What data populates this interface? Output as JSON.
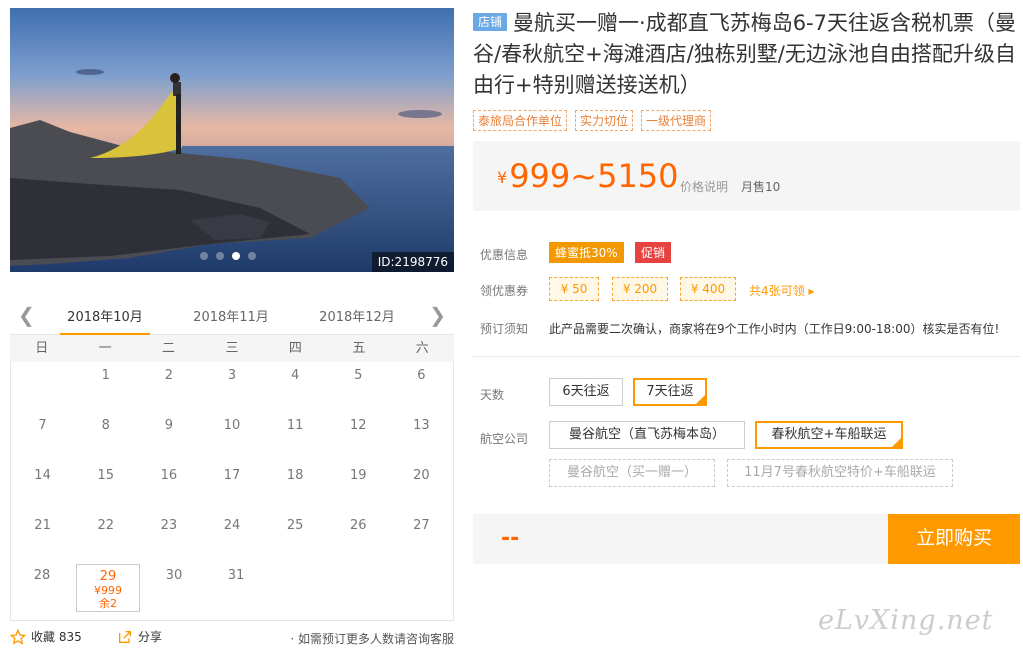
{
  "hero": {
    "image_id": "ID:2198776",
    "slide_count": 4,
    "active_slide": 2
  },
  "calendar": {
    "months": [
      "2018年10月",
      "2018年11月",
      "2018年12月"
    ],
    "active_month": 0,
    "weekdays": [
      "日",
      "一",
      "二",
      "三",
      "四",
      "五",
      "六"
    ],
    "rows": [
      [
        "",
        "1",
        "2",
        "3",
        "4",
        "5",
        "6"
      ],
      [
        "7",
        "8",
        "9",
        "10",
        "11",
        "12",
        "13"
      ],
      [
        "14",
        "15",
        "16",
        "17",
        "18",
        "19",
        "20"
      ],
      [
        "21",
        "22",
        "23",
        "24",
        "25",
        "26",
        "27"
      ],
      [
        "28",
        "29",
        "30",
        "31",
        "",
        "",
        ""
      ]
    ],
    "selected": {
      "day": "29",
      "price": "¥999",
      "remaining": "余2"
    }
  },
  "footer_left": {
    "favorite_label": "收藏 835",
    "share_label": "分享",
    "consult_note": "· 如需预订更多人数请咨询客服"
  },
  "product": {
    "store_tag": "店铺",
    "title": "曼航买一赠一·成都直飞苏梅岛6-7天往返含税机票（曼谷/春秋航空+海滩酒店/独栋别墅/无边泳池自由搭配升级自由行+特别赠送接送机）",
    "badges": [
      "泰旅局合作单位",
      "实力切位",
      "一级代理商"
    ]
  },
  "price": {
    "currency": "¥",
    "range": "999~5150",
    "explain": "价格说明",
    "sales": "月售10"
  },
  "promo": {
    "label": "优惠信息",
    "tags": [
      {
        "text": "蜂蜜抵30%",
        "color": "#f39800"
      },
      {
        "text": "促销",
        "color": "#e64340"
      }
    ]
  },
  "coupons": {
    "label": "领优惠券",
    "items": [
      "¥ 50",
      "¥ 200",
      "¥ 400"
    ],
    "more": "共4张可领 ▸"
  },
  "booking": {
    "label": "预订须知",
    "text": "此产品需要二次确认，商家将在9个工作小时内（工作日9:00-18:00）核实是否有位!"
  },
  "days": {
    "label": "天数",
    "options": [
      "6天往返",
      "7天往返"
    ],
    "selected": 1
  },
  "airline": {
    "label": "航空公司",
    "options": [
      "曼谷航空（直飞苏梅本岛）",
      "春秋航空+车船联运"
    ],
    "selected": 1,
    "disabled": [
      "曼谷航空（买一赠一）",
      "11月7号春秋航空特价+车船联运"
    ]
  },
  "purchase": {
    "total": "--",
    "buy_label": "立即购买"
  },
  "watermark": "eLvXing.net",
  "colors": {
    "accent": "#f90",
    "price": "#f60",
    "store_tag": "#6aa8e6"
  }
}
